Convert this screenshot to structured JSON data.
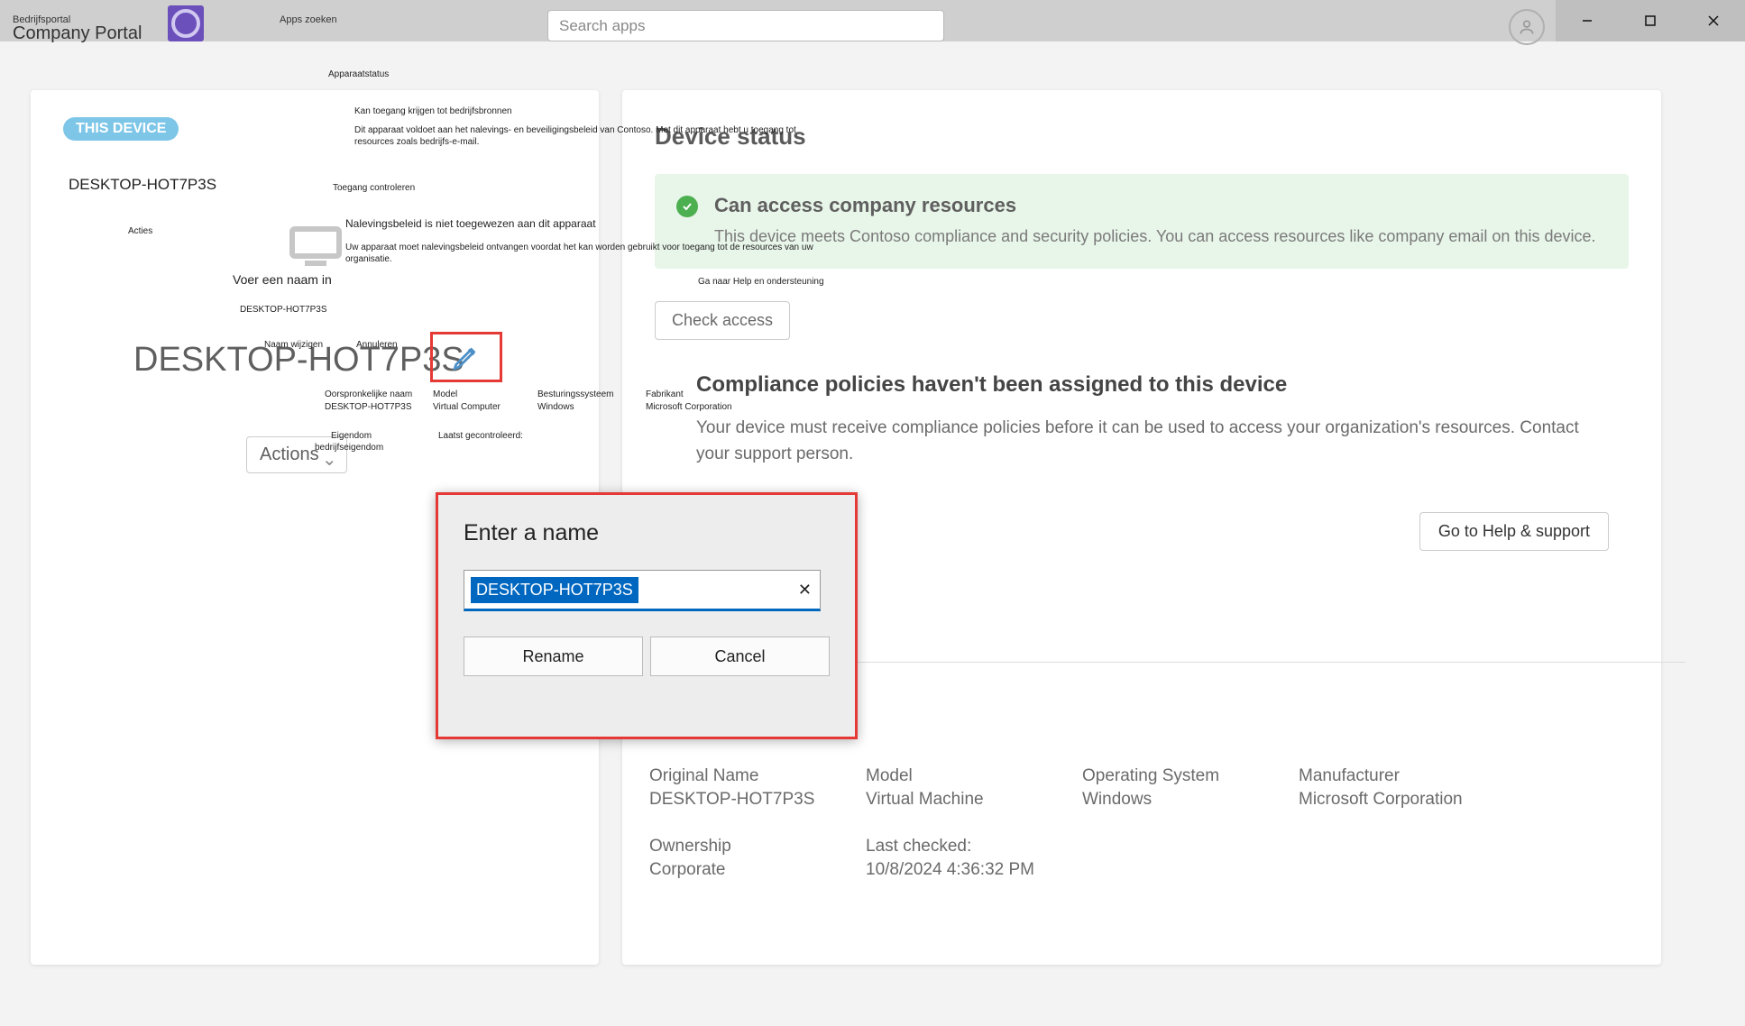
{
  "titlebar": {
    "small_label": "Bedrijfsportal",
    "app_name": "Company Portal",
    "apps_zoeken": "Apps zoeken",
    "search_placeholder": "Search apps"
  },
  "left": {
    "this_device_badge": "THIS DEVICE",
    "device_title_small": "DESKTOP-HOT7P3S",
    "voer_naam": "Voer een naam in",
    "mini_dev": "DESKTOP-HOT7P3S",
    "big_name": "DESKTOP-HOT7P3S",
    "actions_label": "Actions"
  },
  "nl": {
    "apparaatstatus": "Apparaatstatus",
    "kan_toegang": "Kan toegang krijgen tot bedrijfsbronnen",
    "voldoet": "Dit apparaat voldoet aan het nalevings- en beveiligingsbeleid van Contoso. Met dit apparaat hebt u toegang tot resources zoals bedrijfs-e-mail.",
    "toegang_controleren": "Toegang controleren",
    "naleving_title": "Nalevingsbeleid is niet toegewezen aan dit apparaat",
    "naleving_body": "Uw apparaat moet nalevingsbeleid ontvangen voordat het kan worden gebruikt voor toegang tot de resources van uw organisatie.",
    "acties": "Acties",
    "naam_wijzigen": "Naam wijzigen",
    "annuleren": "Annuleren",
    "orig_name_lbl": "Oorspronkelijke naam",
    "orig_name_val": "DESKTOP-HOT7P3S",
    "model_lbl": "Model",
    "model_val": "Virtual Computer",
    "os_lbl": "Besturingssysteem",
    "os_val": "Windows",
    "maker_lbl": "Fabrikant",
    "maker_val": "Microsoft Corporation",
    "eigendom_lbl": "Eigendom",
    "eigendom_val": "bedrijfseigendom",
    "laatst": "Laatst gecontroleerd:",
    "ga_help": "Ga naar Help en ondersteuning"
  },
  "right": {
    "device_status": "Device status",
    "can_access_title": "Can access company resources",
    "can_access_body": "This device meets Contoso compliance and security policies. You can access resources like company email on this device.",
    "check_access": "Check access",
    "compliance_title": "Compliance policies haven't been assigned to this device",
    "compliance_body": "Your device must receive compliance policies before it can be used to access your organization's resources. Contact your support person.",
    "goto_help": "Go to Help & support"
  },
  "info": {
    "orig_name_lbl": "Original Name",
    "orig_name_val": "DESKTOP-HOT7P3S",
    "model_lbl": "Model",
    "model_val": "Virtual Machine",
    "os_lbl": "Operating System",
    "os_val": "Windows",
    "maker_lbl": "Manufacturer",
    "maker_val": "Microsoft Corporation",
    "owner_lbl": "Ownership",
    "owner_val": "Corporate",
    "last_lbl": "Last checked:",
    "last_val": "10/8/2024 4:36:32 PM"
  },
  "dialog": {
    "title": "Enter a name",
    "value": "DESKTOP-HOT7P3S",
    "rename": "Rename",
    "cancel": "Cancel"
  }
}
